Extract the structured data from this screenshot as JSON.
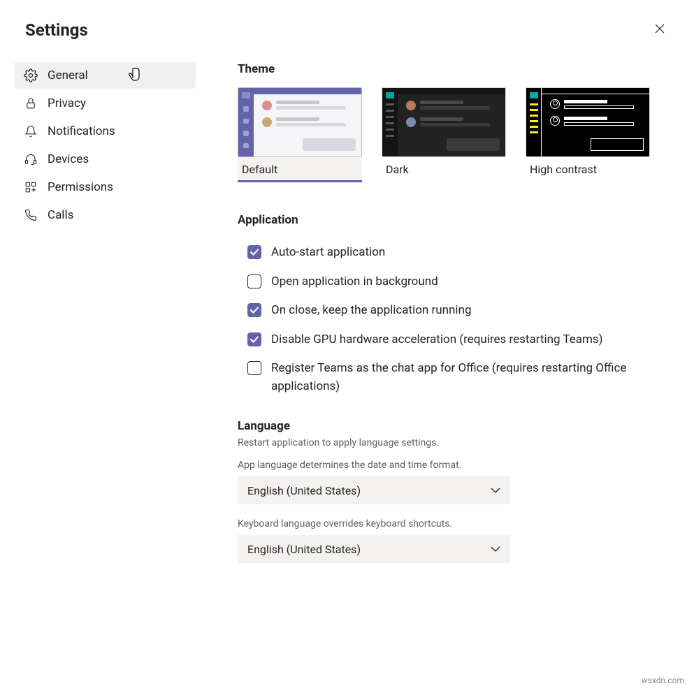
{
  "header": {
    "title": "Settings"
  },
  "sidebar": {
    "items": [
      {
        "label": "General"
      },
      {
        "label": "Privacy"
      },
      {
        "label": "Notifications"
      },
      {
        "label": "Devices"
      },
      {
        "label": "Permissions"
      },
      {
        "label": "Calls"
      }
    ]
  },
  "theme": {
    "heading": "Theme",
    "options": [
      {
        "label": "Default"
      },
      {
        "label": "Dark"
      },
      {
        "label": "High contrast"
      }
    ]
  },
  "application": {
    "heading": "Application",
    "options": [
      {
        "label": "Auto-start application",
        "checked": true
      },
      {
        "label": "Open application in background",
        "checked": false
      },
      {
        "label": "On close, keep the application running",
        "checked": true
      },
      {
        "label": "Disable GPU hardware acceleration (requires restarting Teams)",
        "checked": true
      },
      {
        "label": "Register Teams as the chat app for Office (requires restarting Office applications)",
        "checked": false
      }
    ]
  },
  "language": {
    "heading": "Language",
    "restart_note": "Restart application to apply language settings.",
    "app_lang_label": "App language determines the date and time format.",
    "app_lang_value": "English (United States)",
    "kbd_lang_label": "Keyboard language overrides keyboard shortcuts.",
    "kbd_lang_value": "English (United States)"
  },
  "watermark": "wsxdn.com"
}
